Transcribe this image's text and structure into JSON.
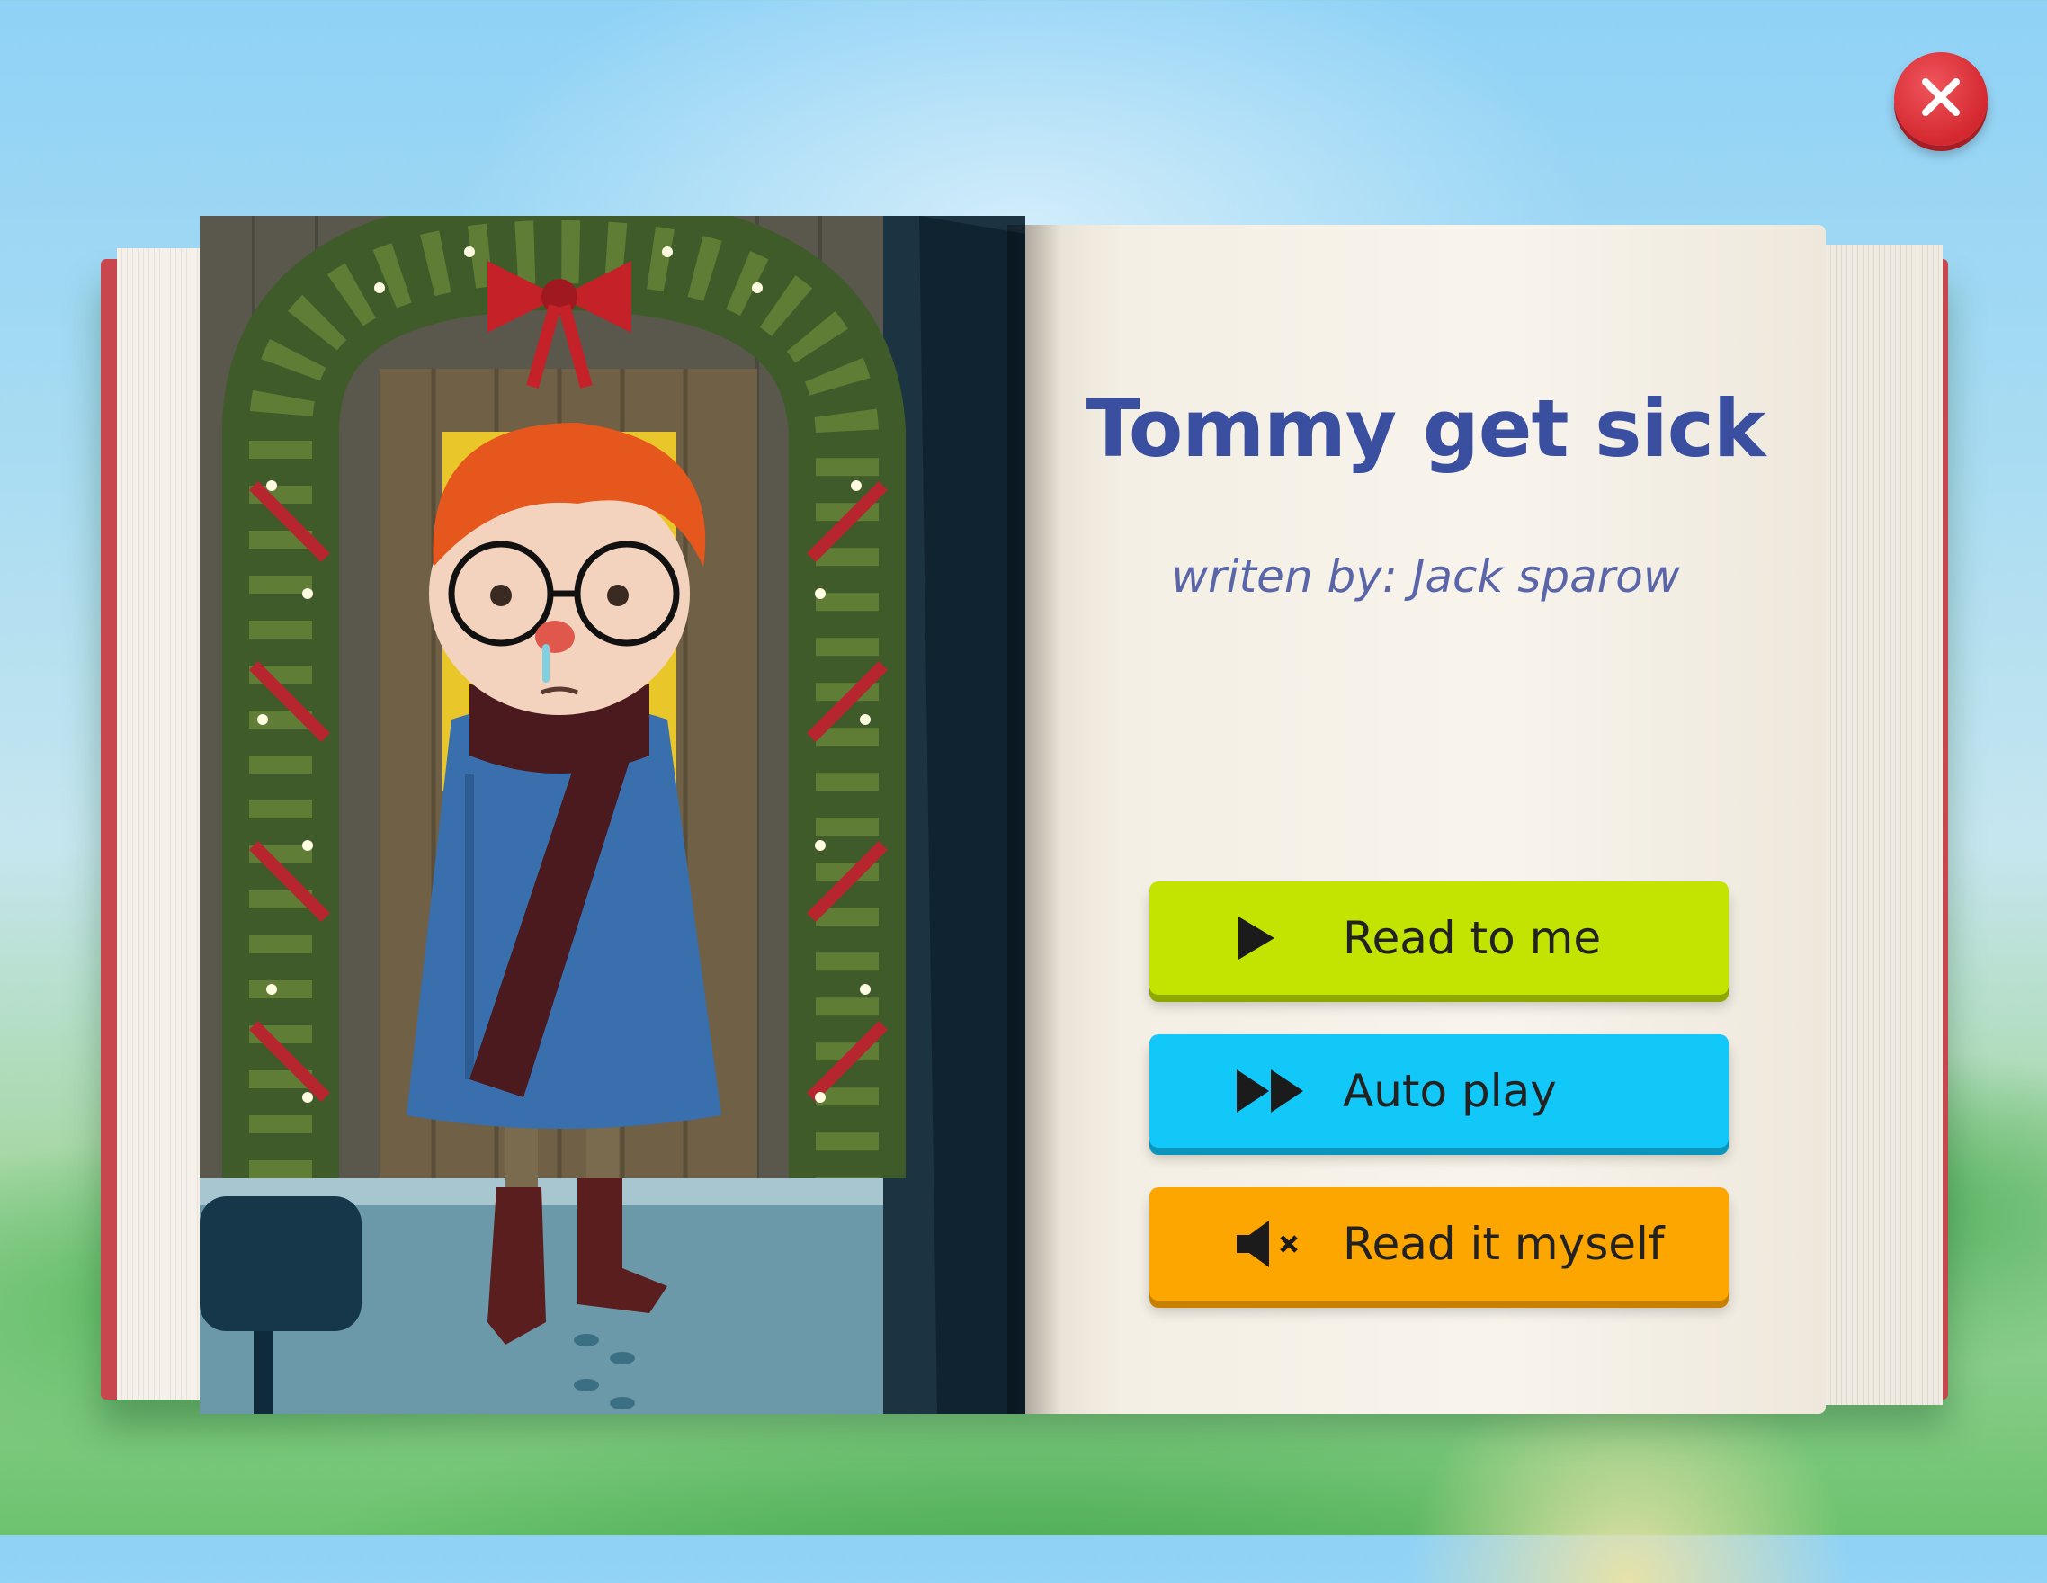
{
  "book": {
    "title": "Tommy get sick",
    "author_line": "writen by: Jack sparow"
  },
  "actions": [
    {
      "label": "Read to me",
      "icon": "play-icon",
      "color": "#c3e400"
    },
    {
      "label": "Auto play",
      "icon": "fast-forward-icon",
      "color": "#12c8f8"
    },
    {
      "label": "Read it myself",
      "icon": "mute-icon",
      "color": "#fea600"
    }
  ],
  "close": {
    "icon": "close-icon",
    "color": "#d42830"
  }
}
